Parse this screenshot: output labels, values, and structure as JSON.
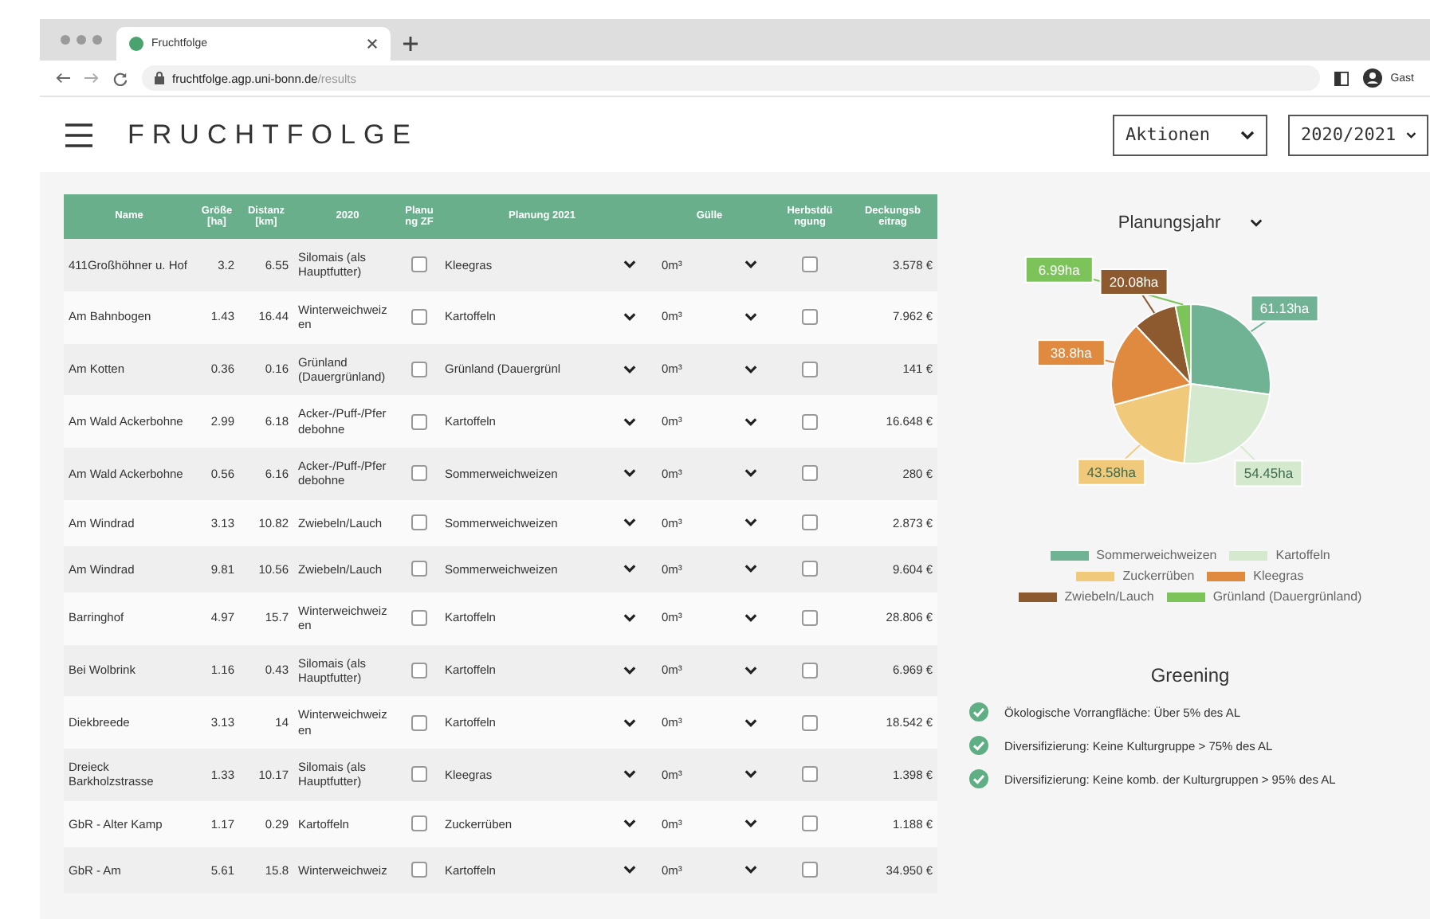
{
  "browser": {
    "tab": {
      "title": "Fruchtfolge"
    },
    "address": {
      "host": "fruchtfolge.agp.uni-bonn.de",
      "path": "/results"
    },
    "profile": "Gast"
  },
  "header": {
    "title": "FRUCHTFOLGE",
    "actions": "Aktionen",
    "year": "2020/2021"
  },
  "table": {
    "columns": [
      "Name",
      "Größe [ha]",
      "Distanz [km]",
      "2020",
      "Planu ng ZF",
      "Planung 2021",
      "Gülle",
      "Herbstdü ngung",
      "Deckungsb eitrag"
    ],
    "rows": [
      {
        "name": "411Großhöhner u. Hof",
        "size": "3.2",
        "distance": "6.55",
        "crop_2020": "Silomais (als Hauptfutter)",
        "zf": false,
        "plan": "Kleegras",
        "manure": "0m³",
        "autumn": false,
        "margin": "3.578 €"
      },
      {
        "name": "Am Bahnbogen",
        "size": "1.43",
        "distance": "16.44",
        "crop_2020": "Winterweichweiz en",
        "zf": false,
        "plan": "Kartoffeln",
        "manure": "0m³",
        "autumn": false,
        "margin": "7.962 €"
      },
      {
        "name": "Am Kotten",
        "size": "0.36",
        "distance": "0.16",
        "crop_2020": "Grünland (Dauergrünland)",
        "zf": false,
        "plan": "Grünland (Dauergrünl",
        "manure": "0m³",
        "autumn": false,
        "margin": "141 €"
      },
      {
        "name": "Am Wald Ackerbohne",
        "size": "2.99",
        "distance": "6.18",
        "crop_2020": "Acker-/Puff-/Pfer debohne",
        "zf": false,
        "plan": "Kartoffeln",
        "manure": "0m³",
        "autumn": false,
        "margin": "16.648 €"
      },
      {
        "name": "Am Wald Ackerbohne",
        "size": "0.56",
        "distance": "6.16",
        "crop_2020": "Acker-/Puff-/Pfer debohne",
        "zf": false,
        "plan": "Sommerweichweizen",
        "manure": "0m³",
        "autumn": false,
        "margin": "280 €"
      },
      {
        "name": "Am Windrad",
        "size": "3.13",
        "distance": "10.82",
        "crop_2020": "Zwiebeln/Lauch",
        "zf": false,
        "plan": "Sommerweichweizen",
        "manure": "0m³",
        "autumn": false,
        "margin": "2.873 €"
      },
      {
        "name": "Am Windrad",
        "size": "9.81",
        "distance": "10.56",
        "crop_2020": "Zwiebeln/Lauch",
        "zf": false,
        "plan": "Sommerweichweizen",
        "manure": "0m³",
        "autumn": false,
        "margin": "9.604 €"
      },
      {
        "name": "Barringhof",
        "size": "4.97",
        "distance": "15.7",
        "crop_2020": "Winterweichweiz en",
        "zf": false,
        "plan": "Kartoffeln",
        "manure": "0m³",
        "autumn": false,
        "margin": "28.806 €"
      },
      {
        "name": "Bei Wolbrink",
        "size": "1.16",
        "distance": "0.43",
        "crop_2020": "Silomais (als Hauptfutter)",
        "zf": false,
        "plan": "Kartoffeln",
        "manure": "0m³",
        "autumn": false,
        "margin": "6.969 €"
      },
      {
        "name": "Diekbreede",
        "size": "3.13",
        "distance": "14",
        "crop_2020": "Winterweichweiz en",
        "zf": false,
        "plan": "Kartoffeln",
        "manure": "0m³",
        "autumn": false,
        "margin": "18.542 €"
      },
      {
        "name": "Dreieck Barkholzstrasse",
        "size": "1.33",
        "distance": "10.17",
        "crop_2020": "Silomais (als Hauptfutter)",
        "zf": false,
        "plan": "Kleegras",
        "manure": "0m³",
        "autumn": false,
        "margin": "1.398 €"
      },
      {
        "name": "GbR - Alter Kamp",
        "size": "1.17",
        "distance": "0.29",
        "crop_2020": "Kartoffeln",
        "zf": false,
        "plan": "Zuckerrüben",
        "manure": "0m³",
        "autumn": false,
        "margin": "1.188 €"
      },
      {
        "name": "GbR - Am",
        "size": "5.61",
        "distance": "15.8",
        "crop_2020": "Winterweichweiz",
        "zf": false,
        "plan": "Kartoffeln",
        "manure": "0m³",
        "autumn": false,
        "margin": "34.950 €"
      }
    ]
  },
  "chart_panel": {
    "selector": "Planungsjahr",
    "chart_data": {
      "type": "pie",
      "categories": [
        "Sommerweichweizen",
        "Kartoffeln",
        "Zuckerrüben",
        "Kleegras",
        "Zwiebeln/Lauch",
        "Grünland (Dauergrünland)"
      ],
      "values": [
        61.13,
        54.45,
        43.58,
        38.8,
        20.08,
        6.99
      ],
      "value_labels": [
        "61.13ha",
        "54.45ha",
        "43.58ha",
        "38.8ha",
        "20.08ha",
        "6.99ha"
      ],
      "colors": [
        "#6fb394",
        "#d5e9cf",
        "#f0c97a",
        "#df8a3e",
        "#8d5a30",
        "#7cc45a"
      ],
      "legend": "bottom"
    }
  },
  "greening": {
    "title": "Greening",
    "items": [
      {
        "text": "Ökologische Vorrangfläche: Über 5% des AL",
        "ok": true
      },
      {
        "text": "Diversifizierung: Keine Kulturgruppe > 75% des AL",
        "ok": true
      },
      {
        "text": "Diversifizierung: Keine komb. der Kulturgruppen > 95% des AL",
        "ok": true
      }
    ]
  }
}
